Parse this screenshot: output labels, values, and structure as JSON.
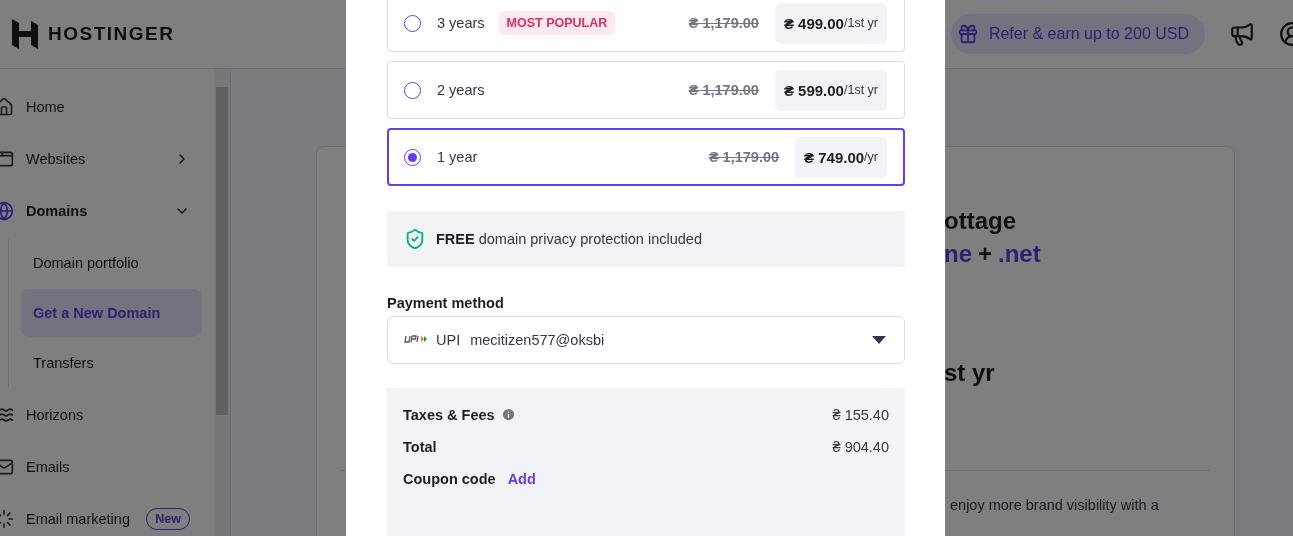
{
  "header": {
    "brand": "HOSTINGER",
    "refer": "Refer & earn up to 200 USD"
  },
  "sidebar": {
    "items": [
      {
        "label": "Home",
        "selected": false
      },
      {
        "label": "Websites",
        "selected": false,
        "expanded": false
      },
      {
        "label": "Domains",
        "selected": true,
        "expanded": true,
        "children": [
          {
            "label": "Domain portfolio",
            "selected": false
          },
          {
            "label": "Get a New Domain",
            "selected": true
          },
          {
            "label": "Transfers",
            "selected": false
          }
        ]
      },
      {
        "label": "Horizons",
        "selected": false
      },
      {
        "label": "Emails",
        "selected": false
      },
      {
        "label": "Email marketing",
        "selected": false,
        "badge": "New"
      }
    ]
  },
  "card": {
    "title_fragment": "ottage",
    "domains": [
      {
        "text": "ne",
        "kind": "tld"
      },
      {
        "text": "+",
        "kind": "plus"
      },
      {
        "text": ".net",
        "kind": "tld"
      }
    ],
    "price_fragment": "st yr",
    "note_fragment": "enjoy more brand visibility with a"
  },
  "modal": {
    "plans": [
      {
        "label": "3 years",
        "badge": "MOST POPULAR",
        "old_price": "₴ 1,179.00",
        "price": "₴ 499.00",
        "unit": "/1st yr",
        "selected": false
      },
      {
        "label": "2 years",
        "old_price": "₴ 1,179.00",
        "price": "₴ 599.00",
        "unit": "/1st yr",
        "selected": false
      },
      {
        "label": "1 year",
        "old_price": "₴ 1,179.00",
        "price": "₴ 749.00",
        "unit": "/yr",
        "selected": true
      }
    ],
    "privacy": "**FREE** domain privacy protection included",
    "payment": {
      "label": "Payment method",
      "method": "UPI",
      "account": "mecitizen577@oksbi"
    },
    "summary": [
      {
        "label": "Taxes & Fees",
        "value": "₴ 155.40",
        "info": true
      },
      {
        "label": "Total",
        "value": "₴ 904.40",
        "info": false
      }
    ],
    "coupon": {
      "label": "Coupon code",
      "action": "Add"
    }
  }
}
